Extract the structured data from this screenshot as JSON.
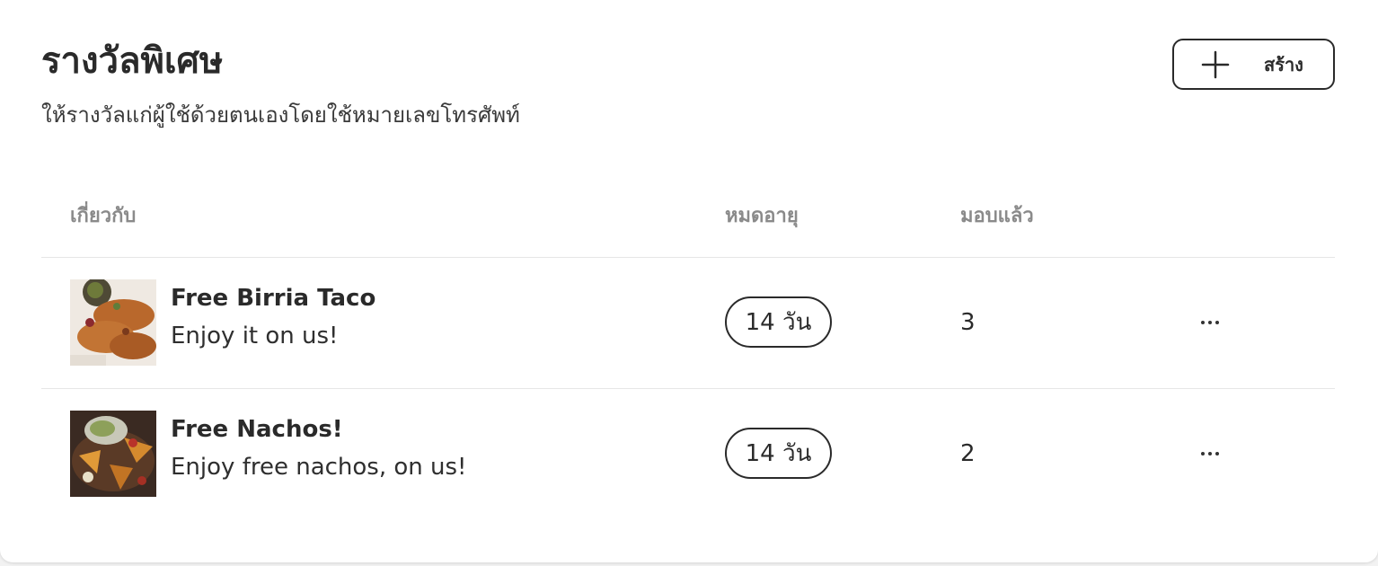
{
  "header": {
    "title": "รางวัลพิเศษ",
    "subtitle": "ให้รางวัลแก่ผู้ใช้ด้วยตนเองโดยใช้หมายเลขโทรศัพท์",
    "create_label": "สร้าง"
  },
  "table": {
    "headers": {
      "about": "เกี่ยวกับ",
      "expires": "หมดอายุ",
      "given": "มอบแล้ว"
    },
    "rows": [
      {
        "title": "Free Birria Taco",
        "description": "Enjoy it on us!",
        "expiry": "14 วัน",
        "given": "3"
      },
      {
        "title": "Free Nachos!",
        "description": "Enjoy free nachos, on us!",
        "expiry": "14 วัน",
        "given": "2"
      }
    ]
  },
  "icons": {
    "create": "plus-icon",
    "row_menu": "more-horizontal-icon"
  }
}
